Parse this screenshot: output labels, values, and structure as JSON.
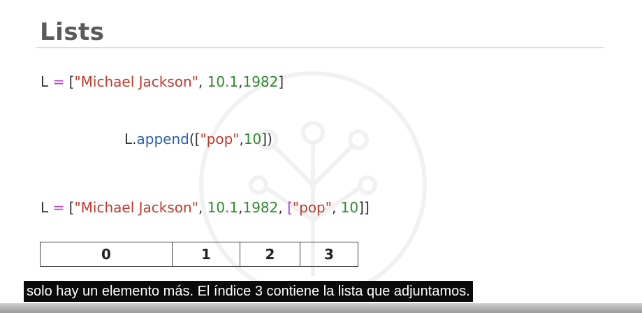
{
  "slide": {
    "title": "Lists"
  },
  "code": {
    "line1": {
      "ident": "L",
      "op": "=",
      "open": "[",
      "str1": "\"Michael Jackson\"",
      "sep1": ", ",
      "num1": "10.1",
      "sep2": ",",
      "num2": "1982",
      "close": "]"
    },
    "line2": {
      "ident": "L.",
      "method": "append",
      "open": "([",
      "str1": "\"pop\"",
      "sep1": ",",
      "num1": "10",
      "close": "])"
    },
    "line3": {
      "ident": "L",
      "op": "=",
      "open": "[",
      "str1": "\"Michael Jackson\"",
      "sep1": ", ",
      "num1": "10.1",
      "sep2": ",",
      "num2": "1982",
      "sep3": ", ",
      "open2": "[",
      "str2": "\"pop\"",
      "sep4": ", ",
      "num3": "10",
      "close2": "]",
      "close": "]"
    }
  },
  "index_table": {
    "cells": [
      "0",
      "1",
      "2",
      "3"
    ]
  },
  "caption": {
    "text": "solo hay un elemento más. El índice 3 contiene la lista que adjuntamos."
  },
  "colors": {
    "title": "#5a5a5a",
    "string": "#c0392b",
    "number": "#2e8b2e",
    "operator": "#b43fd1",
    "method": "#2a5fb0"
  },
  "icons": {
    "watermark": "tree-network-logo-icon"
  }
}
